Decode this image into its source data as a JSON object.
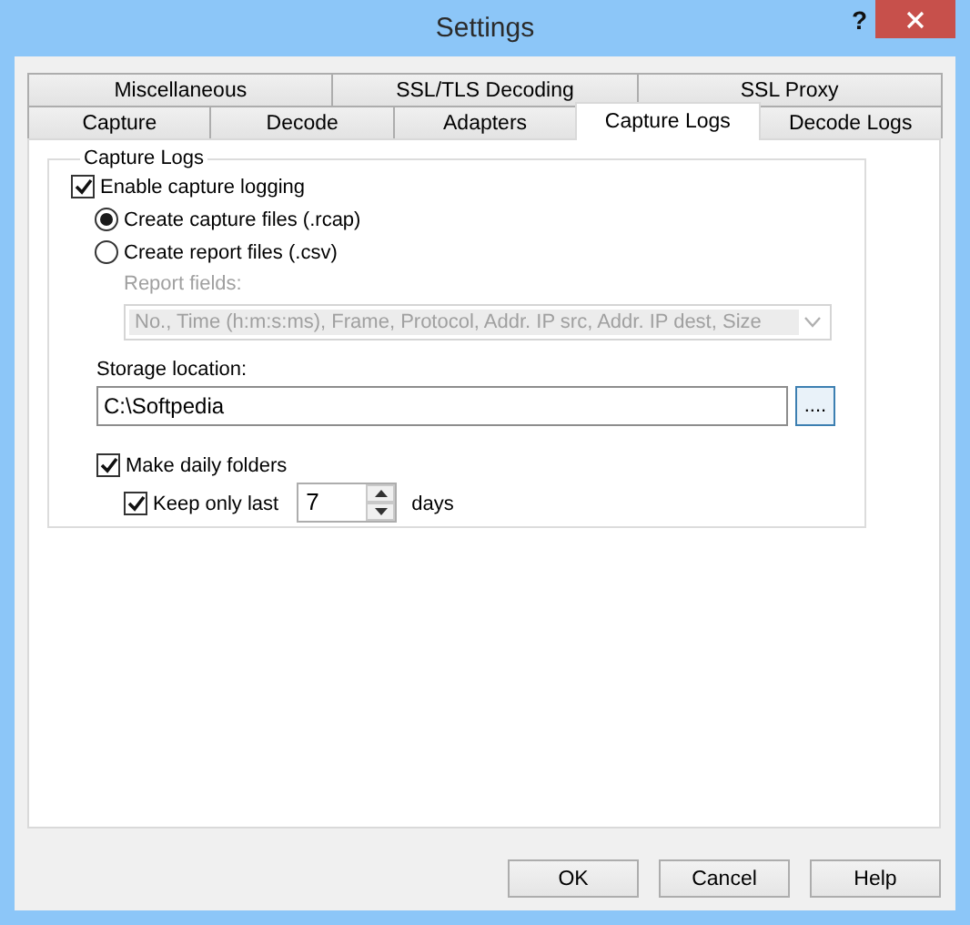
{
  "window": {
    "title": "Settings",
    "help": "?"
  },
  "tab_rows": [
    [
      {
        "label": "Miscellaneous",
        "selected": false
      },
      {
        "label": "SSL/TLS Decoding",
        "selected": false
      },
      {
        "label": "SSL Proxy",
        "selected": false
      }
    ],
    [
      {
        "label": "Capture",
        "selected": false
      },
      {
        "label": "Decode",
        "selected": false
      },
      {
        "label": "Adapters",
        "selected": false
      },
      {
        "label": "Capture Logs",
        "selected": true
      },
      {
        "label": "Decode Logs",
        "selected": false
      }
    ]
  ],
  "capture_logs": {
    "title": "Capture Logs",
    "enable_logging": {
      "label": "Enable capture logging",
      "checked": true
    },
    "file_types": [
      {
        "label": "Create capture files (.rcap)",
        "selected": true
      },
      {
        "label": "Create report files (.csv)",
        "selected": false
      }
    ],
    "report_fields": {
      "label": "Report fields:",
      "value": "No., Time (h:m:s:ms), Frame, Protocol, Addr. IP src, Addr. IP dest, Size",
      "disabled": true
    },
    "storage": {
      "label": "Storage location:",
      "value": "C:\\Softpedia",
      "browse": "...."
    },
    "daily_folders": {
      "label": "Make daily folders",
      "checked": true
    },
    "keep_last": {
      "label": "Keep only last",
      "checked": true,
      "value": "7",
      "unit": "days"
    }
  },
  "buttons": [
    "OK",
    "Cancel",
    "Help"
  ]
}
